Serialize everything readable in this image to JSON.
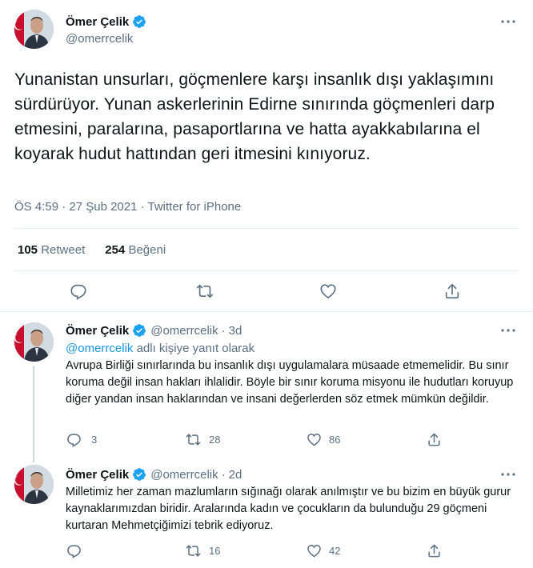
{
  "main_tweet": {
    "display_name": "Ömer Çelik",
    "handle": "@omerrcelik",
    "text": "Yunanistan unsurları, göçmenlere karşı insanlık dışı yaklaşımını sürdürüyor. Yunan askerlerinin Edirne sınırında göçmenleri darp etmesini, paralarına, pasaportlarına ve hatta ayakkabılarına el koyarak hudut hattından geri itmesini kınıyoruz.",
    "meta": "ÖS 4:59 · 27 Şub 2021 · Twitter for iPhone",
    "retweet_count": "105",
    "retweet_label": "Retweet",
    "like_count": "254",
    "like_label": "Beğeni"
  },
  "replies": [
    {
      "display_name": "Ömer Çelik",
      "handle": "@omerrcelik",
      "time": "3d",
      "replying_mention": "@omerrcelik",
      "replying_suffix": "adlı kişiye yanıt olarak",
      "text": "Avrupa Birliği sınırlarında bu insanlık dışı uygulamalara müsaade etmemelidir. Bu sınır koruma değil insan hakları ihlalidir. Böyle bir sınır koruma misyonu ile hudutları koruyup diğer yandan insan haklarından ve insani değerlerden söz etmek mümkün değildir.",
      "reply_count": "3",
      "retweet_count": "28",
      "like_count": "86"
    },
    {
      "display_name": "Ömer Çelik",
      "handle": "@omerrcelik",
      "time": "2d",
      "text": "Milletimiz her zaman mazlumların sığınağı olarak anılmıştır ve bu bizim en büyük gurur kaynaklarımızdan biridir. Aralarında kadın ve çocukların da bulunduğu 29 göçmeni kurtaran Mehmetçiğimizi tebrik ediyoruz.",
      "reply_count": "",
      "retweet_count": "16",
      "like_count": "42"
    }
  ],
  "icons": {
    "verified": "verified-badge-icon",
    "more": "more-icon",
    "reply": "reply-icon",
    "retweet": "retweet-icon",
    "like": "like-icon",
    "share": "share-icon"
  },
  "colors": {
    "accent": "#1da1f2",
    "mention": "#1b95e0",
    "secondary_text": "#5b7083",
    "divider": "#e6ecf0"
  }
}
